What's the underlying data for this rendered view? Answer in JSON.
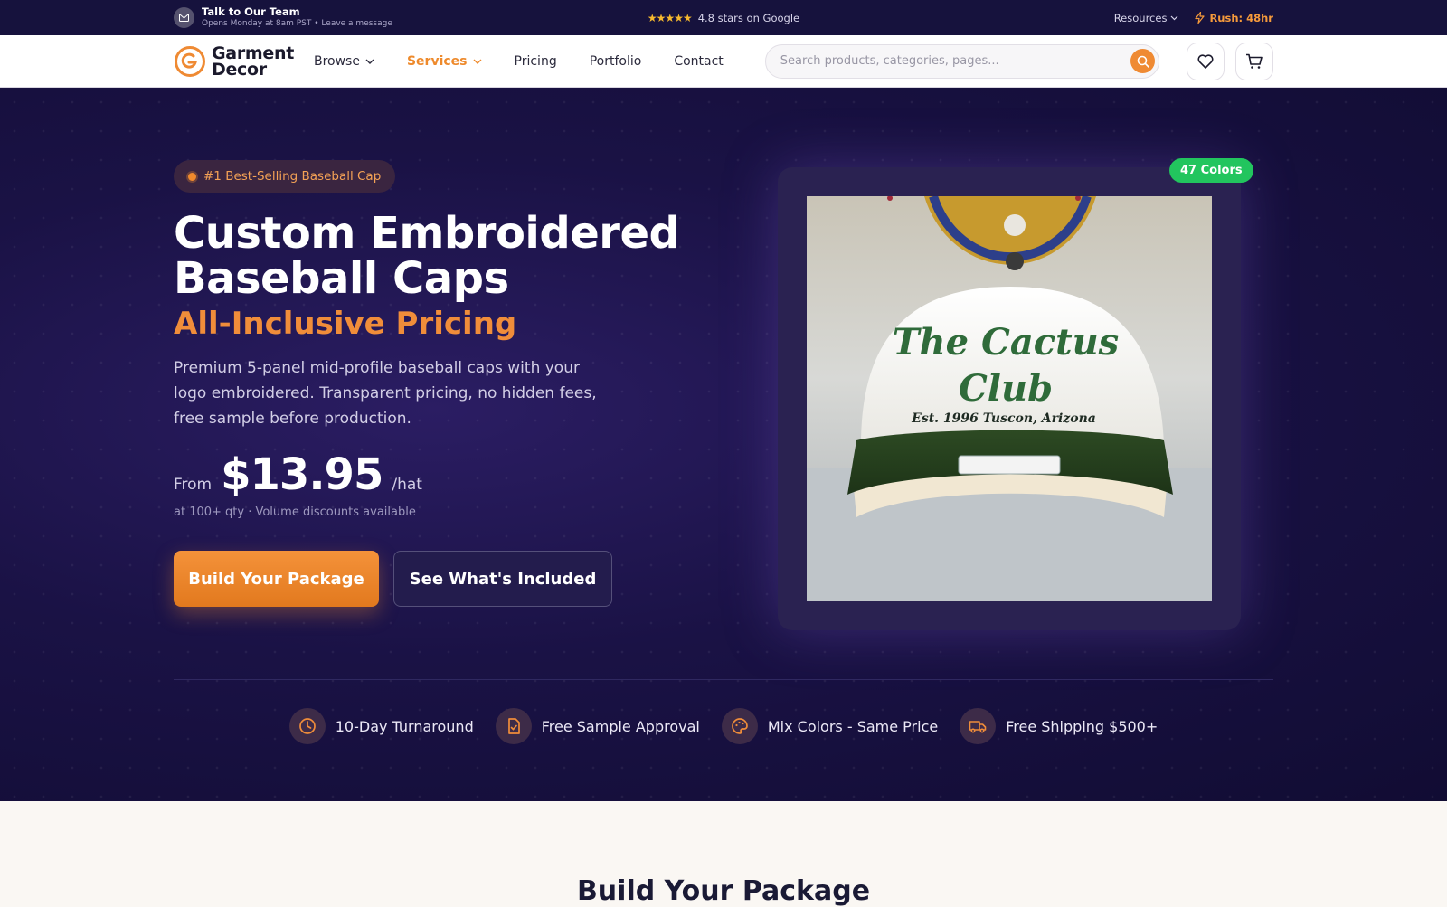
{
  "topbar": {
    "team_title": "Talk to Our Team",
    "team_sub": "Opens Monday at 8am PST • Leave a message",
    "stars": "★★★★★",
    "rating_text": "4.8 stars on Google",
    "resources_label": "Resources",
    "rush_label": "Rush: 48hr"
  },
  "nav": {
    "logo_line1": "Garment",
    "logo_line2": "Decor",
    "items": [
      {
        "label": "Browse"
      },
      {
        "label": "Services"
      },
      {
        "label": "Pricing"
      },
      {
        "label": "Portfolio"
      },
      {
        "label": "Contact"
      }
    ],
    "search_placeholder": "Search products, categories, pages..."
  },
  "hero": {
    "badge": "#1 Best-Selling Baseball Cap",
    "title": "Custom Embroidered Baseball Caps",
    "subtitle": "All-Inclusive Pricing",
    "description": "Premium 5-panel mid-profile baseball caps with your logo embroidered. Transparent pricing, no hidden fees, free sample before production.",
    "price_from": "From",
    "price": "$13.95",
    "price_unit": "/hat",
    "price_note": "at 100+ qty · Volume discounts available",
    "primary_button": "Build Your Package",
    "secondary_button": "See What's Included",
    "colors_badge": "47 Colors",
    "cap_text_1": "The Cactus",
    "cap_text_2": "Club",
    "cap_text_3": "Est. 1996 Tuscon, Arizona"
  },
  "features": [
    {
      "label": "10-Day Turnaround",
      "icon": "clock-icon"
    },
    {
      "label": "Free Sample Approval",
      "icon": "document-check-icon"
    },
    {
      "label": "Mix Colors - Same Price",
      "icon": "palette-icon"
    },
    {
      "label": "Free Shipping $500+",
      "icon": "truck-icon"
    }
  ],
  "section": {
    "heading": "Build Your Package"
  },
  "colors": {
    "accent": "#ef8a33",
    "hero_bg": "#1a1245",
    "badge_green": "#22c55e"
  }
}
